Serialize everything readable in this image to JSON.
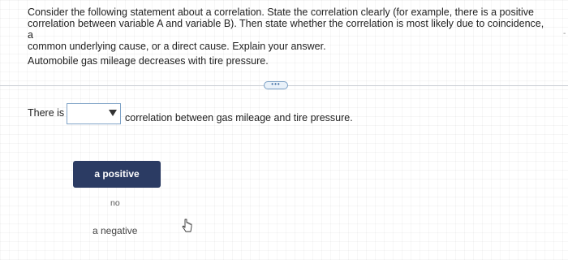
{
  "question": {
    "line1": "Consider the following statement about a correlation. State the correlation clearly (for example, there is a positive",
    "line2": "correlation between variable A and variable B). Then state whether the correlation is most likely due to coincidence, a",
    "line3": "common underlying cause, or a direct cause. Explain your answer.",
    "statement": "Automobile gas mileage decreases with tire pressure."
  },
  "more_button_label": "•••",
  "answer": {
    "prefix": "There is",
    "selected_value": "",
    "suffix": "correlation between gas mileage and tire pressure."
  },
  "dropdown_options": [
    {
      "label": "a positive",
      "highlighted": true
    },
    {
      "label": "no",
      "highlighted": false
    },
    {
      "label": "a negative",
      "highlighted": false
    }
  ],
  "colors": {
    "highlight_bg": "#2b3b63",
    "highlight_text": "#ffffff",
    "select_border": "#7fa3c7"
  }
}
